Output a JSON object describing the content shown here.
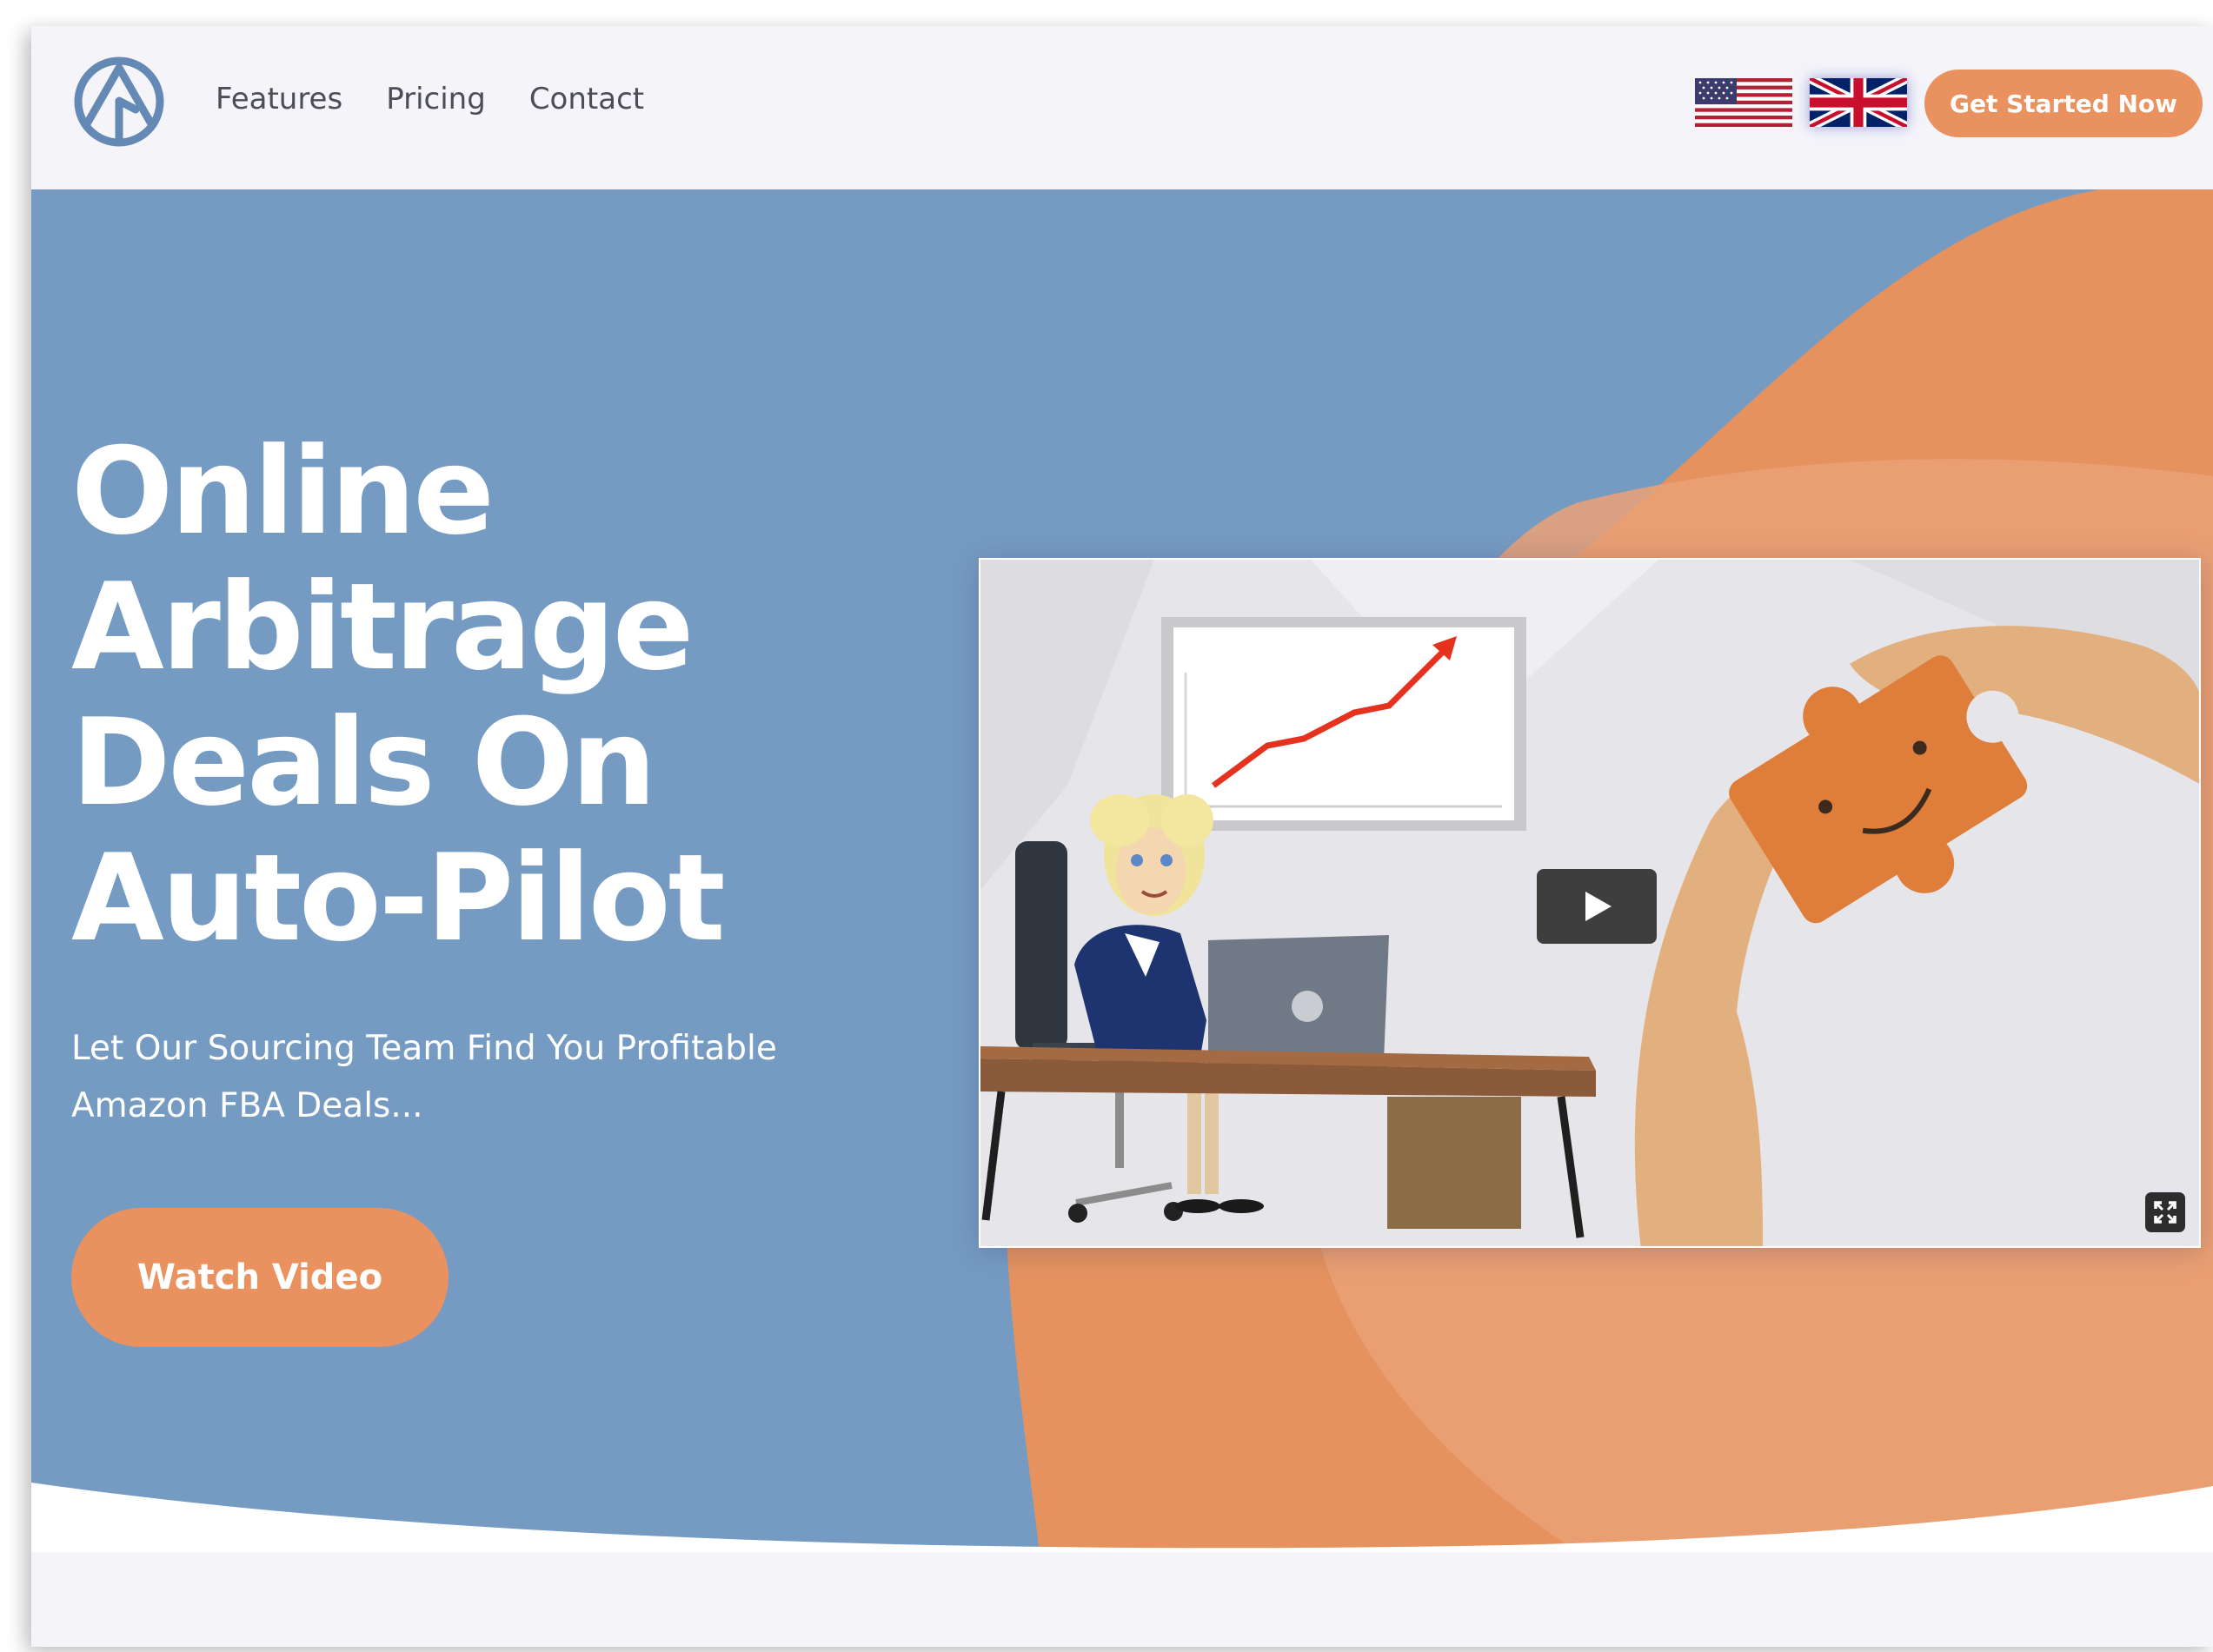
{
  "nav": {
    "logo_icon": "arrow-up-circle-logo",
    "links": [
      {
        "label": "Features"
      },
      {
        "label": "Pricing"
      },
      {
        "label": "Contact"
      }
    ],
    "flags": [
      "us-flag-icon",
      "uk-flag-icon"
    ],
    "cta_label": "Get Started Now"
  },
  "hero": {
    "title_lines": [
      "Online",
      "Arbitrage",
      "Deals On",
      "Auto-Pilot"
    ],
    "subtitle": "Let Our Sourcing Team Find You Profitable Amazon FBA Deals...",
    "watch_label": "Watch Video"
  },
  "video": {
    "play_icon": "play-icon",
    "fullscreen_icon": "fullscreen-icon"
  },
  "colors": {
    "page_bg": "#f4f4f9",
    "hero_blue": "#759bc3",
    "accent_orange": "#ea925f",
    "nav_text": "#4b4d57",
    "logo_blue": "#6389b4"
  }
}
